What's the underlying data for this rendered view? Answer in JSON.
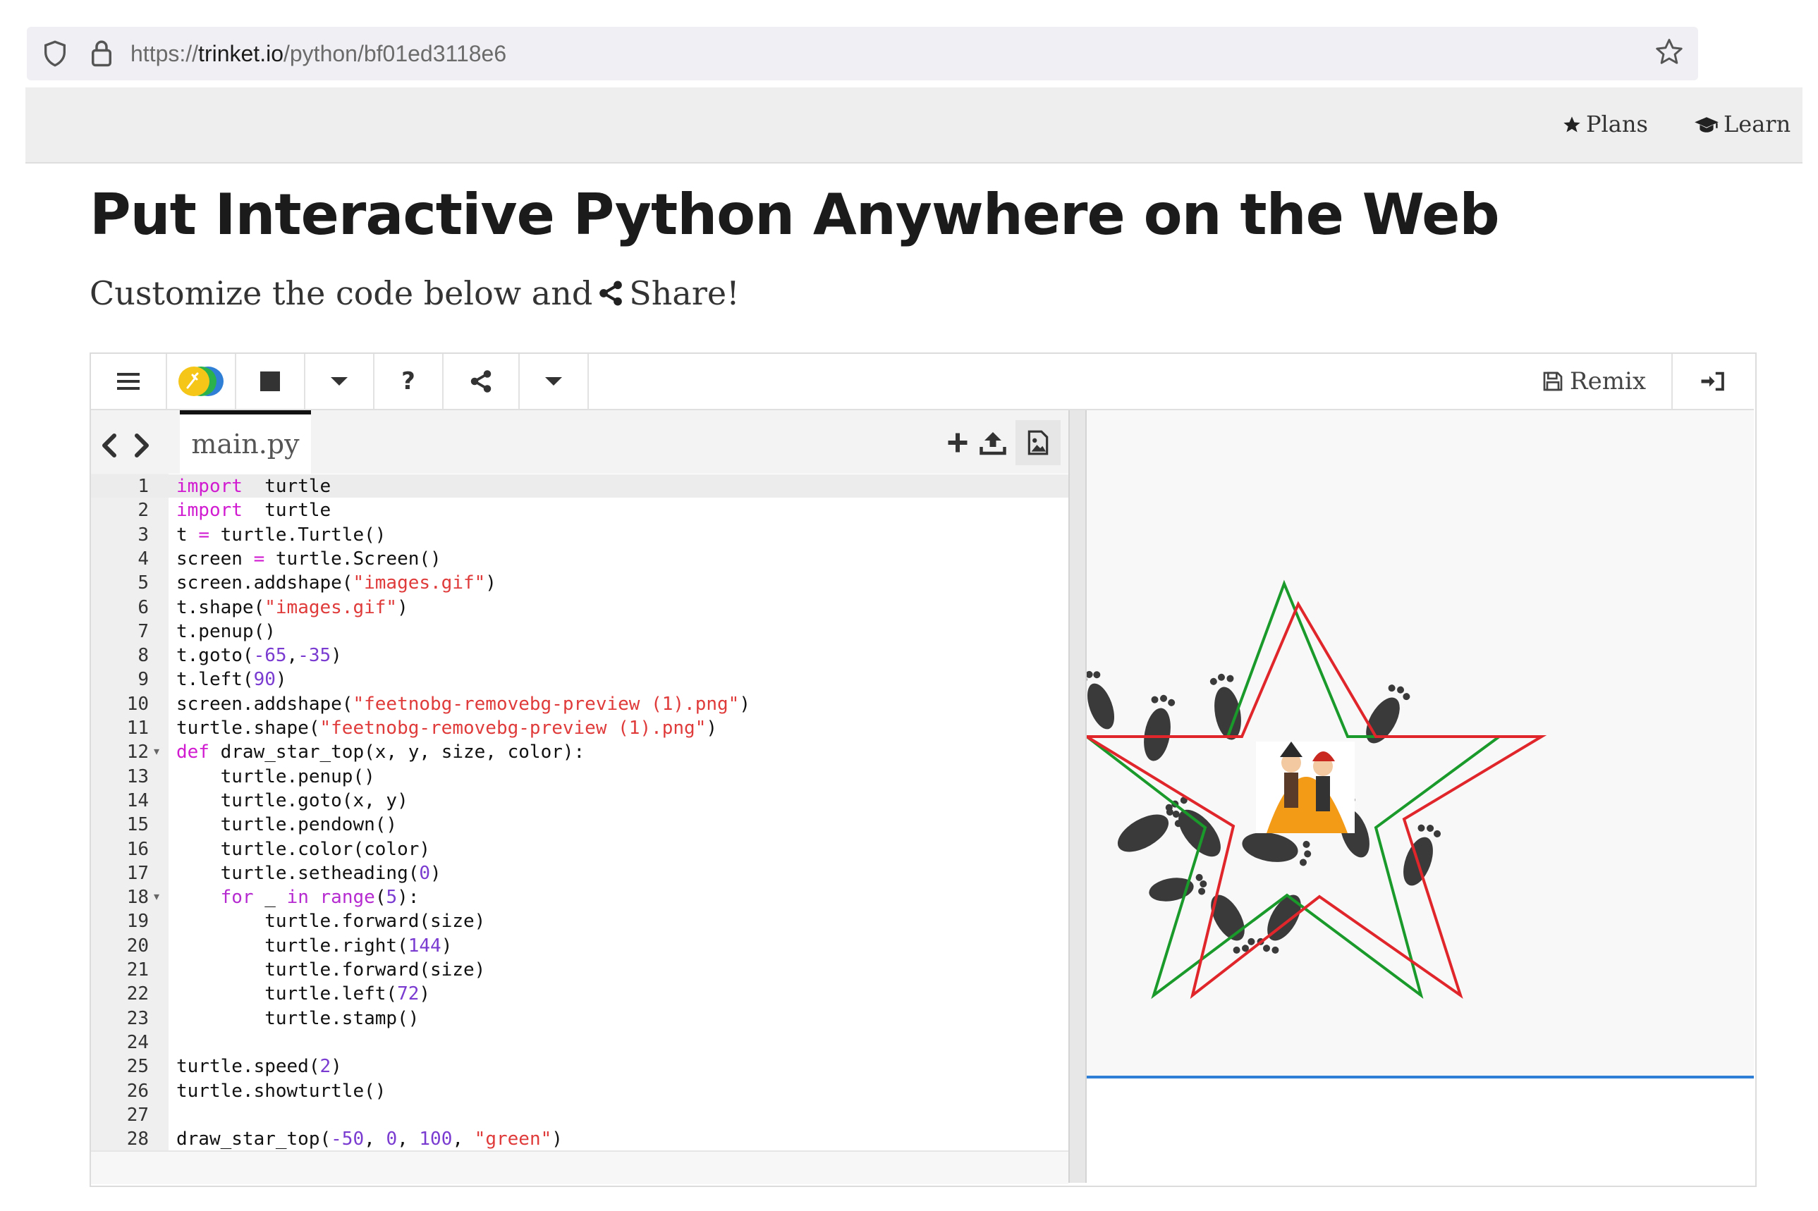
{
  "browser": {
    "url_prefix": "https://",
    "url_domain": "trinket.io",
    "url_path": "/python/bf01ed3118e6",
    "icons": [
      "shield-icon",
      "lock-icon",
      "bookmark-star-icon"
    ]
  },
  "site_nav": {
    "plans_label": "Plans",
    "learn_label": "Learn"
  },
  "page": {
    "title": "Put Interactive Python Anywhere on the Web",
    "subtitle_before": "Customize the code below and",
    "subtitle_after": "Share!"
  },
  "toolbar": {
    "help_label": "?",
    "remix_label": "Remix"
  },
  "editor": {
    "file_tab": "main.py",
    "lines": [
      {
        "n": "1",
        "fold": false,
        "segs": [
          [
            "kw",
            "import"
          ],
          [
            "",
            "  turtle"
          ]
        ]
      },
      {
        "n": "2",
        "fold": false,
        "segs": [
          [
            "kw",
            "import"
          ],
          [
            "",
            "  turtle"
          ]
        ]
      },
      {
        "n": "3",
        "fold": false,
        "segs": [
          [
            "",
            "t "
          ],
          [
            "kw",
            "="
          ],
          [
            "",
            " turtle.Turtle()"
          ]
        ]
      },
      {
        "n": "4",
        "fold": false,
        "segs": [
          [
            "",
            "screen "
          ],
          [
            "kw",
            "="
          ],
          [
            "",
            " turtle.Screen()"
          ]
        ]
      },
      {
        "n": "5",
        "fold": false,
        "segs": [
          [
            "",
            "screen.addshape("
          ],
          [
            "str",
            "\"images.gif\""
          ],
          [
            "",
            ")"
          ]
        ]
      },
      {
        "n": "6",
        "fold": false,
        "segs": [
          [
            "",
            "t.shape("
          ],
          [
            "str",
            "\"images.gif\""
          ],
          [
            "",
            ")"
          ]
        ]
      },
      {
        "n": "7",
        "fold": false,
        "segs": [
          [
            "",
            "t.penup()"
          ]
        ]
      },
      {
        "n": "8",
        "fold": false,
        "segs": [
          [
            "",
            "t.goto("
          ],
          [
            "num",
            "-65"
          ],
          [
            "",
            ","
          ],
          [
            "num",
            "-35"
          ],
          [
            "",
            ")"
          ]
        ]
      },
      {
        "n": "9",
        "fold": false,
        "segs": [
          [
            "",
            "t.left("
          ],
          [
            "num",
            "90"
          ],
          [
            "",
            ")"
          ]
        ]
      },
      {
        "n": "10",
        "fold": false,
        "segs": [
          [
            "",
            "screen.addshape("
          ],
          [
            "str",
            "\"feetnobg-removebg-preview (1).png\""
          ],
          [
            "",
            ")"
          ]
        ]
      },
      {
        "n": "11",
        "fold": false,
        "segs": [
          [
            "",
            "turtle.shape("
          ],
          [
            "str",
            "\"feetnobg-removebg-preview (1).png\""
          ],
          [
            "",
            ")"
          ]
        ]
      },
      {
        "n": "12",
        "fold": true,
        "segs": [
          [
            "kw",
            "def"
          ],
          [
            "",
            " draw_star_top(x, y, size, color):"
          ]
        ]
      },
      {
        "n": "13",
        "fold": false,
        "segs": [
          [
            "",
            "    turtle.penup()"
          ]
        ]
      },
      {
        "n": "14",
        "fold": false,
        "segs": [
          [
            "",
            "    turtle.goto(x, y)"
          ]
        ]
      },
      {
        "n": "15",
        "fold": false,
        "segs": [
          [
            "",
            "    turtle.pendown()"
          ]
        ]
      },
      {
        "n": "16",
        "fold": false,
        "segs": [
          [
            "",
            "    turtle.color(color)"
          ]
        ]
      },
      {
        "n": "17",
        "fold": false,
        "segs": [
          [
            "",
            "    turtle.setheading("
          ],
          [
            "num",
            "0"
          ],
          [
            "",
            ")"
          ]
        ]
      },
      {
        "n": "18",
        "fold": true,
        "segs": [
          [
            "",
            "    "
          ],
          [
            "kw2",
            "for"
          ],
          [
            "",
            " _ "
          ],
          [
            "kw2",
            "in"
          ],
          [
            "",
            " "
          ],
          [
            "kw2",
            "range"
          ],
          [
            "",
            "("
          ],
          [
            "num",
            "5"
          ],
          [
            "",
            "):"
          ]
        ]
      },
      {
        "n": "19",
        "fold": false,
        "segs": [
          [
            "",
            "        turtle.forward(size)"
          ]
        ]
      },
      {
        "n": "20",
        "fold": false,
        "segs": [
          [
            "",
            "        turtle.right("
          ],
          [
            "num",
            "144"
          ],
          [
            "",
            ")"
          ]
        ]
      },
      {
        "n": "21",
        "fold": false,
        "segs": [
          [
            "",
            "        turtle.forward(size)"
          ]
        ]
      },
      {
        "n": "22",
        "fold": false,
        "segs": [
          [
            "",
            "        turtle.left("
          ],
          [
            "num",
            "72"
          ],
          [
            "",
            ")"
          ]
        ]
      },
      {
        "n": "23",
        "fold": false,
        "segs": [
          [
            "",
            "        turtle.stamp()"
          ]
        ]
      },
      {
        "n": "24",
        "fold": false,
        "segs": [
          [
            "",
            ""
          ]
        ]
      },
      {
        "n": "25",
        "fold": false,
        "segs": [
          [
            "",
            "turtle.speed("
          ],
          [
            "num",
            "2"
          ],
          [
            "",
            ")"
          ]
        ]
      },
      {
        "n": "26",
        "fold": false,
        "segs": [
          [
            "",
            "turtle.showturtle()"
          ]
        ]
      },
      {
        "n": "27",
        "fold": false,
        "segs": [
          [
            "",
            ""
          ]
        ]
      },
      {
        "n": "28",
        "fold": false,
        "segs": [
          [
            "",
            "draw_star_top("
          ],
          [
            "num",
            "-50"
          ],
          [
            "",
            ", "
          ],
          [
            "num",
            "0"
          ],
          [
            "",
            ", "
          ],
          [
            "num",
            "100"
          ],
          [
            "",
            ", "
          ],
          [
            "str",
            "\"green\""
          ],
          [
            "",
            ")"
          ]
        ]
      }
    ]
  },
  "output": {
    "star_colors": [
      "#1a9a2a",
      "#e0262b"
    ],
    "stamp_shape": "footprints-stamp",
    "center_image": "costumed-figures-image"
  },
  "colors": {
    "keyword": "#d11bd1",
    "string": "#e03b3b",
    "number": "#7a3bd1",
    "console_divider": "#2f7fd6",
    "run_icon": [
      "#f5c518",
      "#2bb24c",
      "#2f7fd6"
    ]
  }
}
